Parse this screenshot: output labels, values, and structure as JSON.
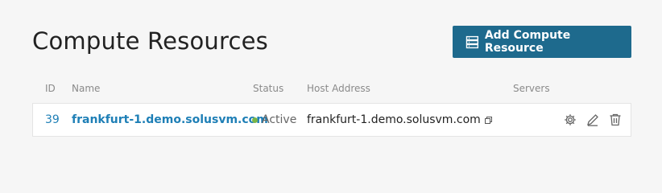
{
  "page": {
    "title": "Compute Resources",
    "add_button_label": "Add Compute Resource",
    "accent_color": "#1e6a8d"
  },
  "table": {
    "columns": [
      "ID",
      "Name",
      "Status",
      "Host Address",
      "Servers"
    ],
    "rows": [
      {
        "id": "39",
        "name": "frankfurt-1.demo.solusvm.com",
        "status": "Active",
        "status_color": "#7ab648",
        "host_address": "frankfurt-1.demo.solusvm.com",
        "servers": "",
        "actions": [
          "gear-icon",
          "pencil-icon",
          "trash-icon"
        ]
      }
    ]
  }
}
